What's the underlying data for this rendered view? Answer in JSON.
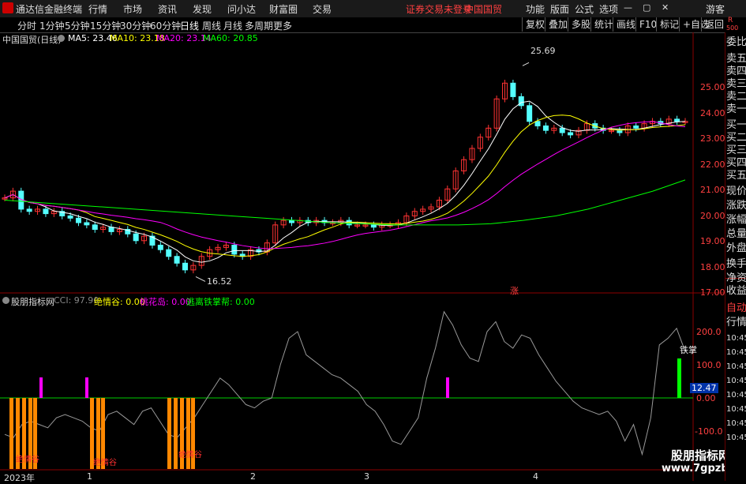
{
  "titlebar": {
    "app_name": "通达信金融终端",
    "menu": [
      "行情",
      "市场",
      "资讯",
      "发现",
      "问小达",
      "财富圈",
      "交易"
    ],
    "alert": "证券交易未登录",
    "stock": "中国国贸",
    "right_menu": [
      "功能",
      "版面",
      "公式",
      "选项"
    ],
    "guest": "游客"
  },
  "toolbar": {
    "periods": [
      "分时",
      "1分钟",
      "5分钟",
      "15分钟",
      "30分钟",
      "60分钟",
      "日线",
      "周线",
      "月线",
      "多周期",
      "更多"
    ],
    "selected": "日线",
    "buttons": [
      "复权",
      "叠加",
      "多股",
      "统计",
      "画线",
      "F10",
      "标记",
      "+自选",
      "返回"
    ]
  },
  "main_panel": {
    "title": "中国国贸(日线)",
    "ma": [
      {
        "label": "MA5: 23.46",
        "color": "#ffffff"
      },
      {
        "label": "MA10: 23.18",
        "color": "#ffff00"
      },
      {
        "label": "MA20: 23.14",
        "color": "#ff00ff"
      },
      {
        "label": "MA60: 20.85",
        "color": "#00ff00"
      }
    ],
    "high_label": "25.69",
    "low_label": "16.52",
    "zhang_label": "涨",
    "y_ticks": [
      "25.00",
      "24.00",
      "23.00",
      "22.00",
      "21.00",
      "20.00",
      "19.00",
      "18.00",
      "17.00"
    ]
  },
  "sub_panel": {
    "title": "股朋指标网",
    "items": [
      {
        "label": "CCI: 97.90",
        "color": "#888888"
      },
      {
        "label": "绝情谷: 0.00",
        "color": "#ffff00"
      },
      {
        "label": "桃花岛: 0.00",
        "color": "#ff00ff"
      },
      {
        "label": "逃离铁掌帮: 0.00",
        "color": "#00ff00"
      }
    ],
    "y_ticks": [
      "200.0",
      "100.0",
      "0.00",
      "-100.0"
    ],
    "current_value": "12.47",
    "bottom_text_1": "绝情谷",
    "bottom_text_2": "绝情谷",
    "bottom_text_3": "绝情谷",
    "side_label": "铁掌"
  },
  "x_axis": [
    "2023年",
    "1",
    "2",
    "3",
    "4"
  ],
  "side_panel": {
    "rr": "R",
    "num": "500",
    "items": [
      "委比",
      "卖五",
      "卖四",
      "卖三",
      "卖二",
      "卖一",
      "买一",
      "买二",
      "买三",
      "买四",
      "买五",
      "现价",
      "涨跌",
      "涨幅",
      "总量",
      "外盘",
      "换手",
      "净资",
      "收益",
      "自动",
      "行情"
    ],
    "times": [
      "10:45",
      "10:45",
      "10:45",
      "10:45",
      "10:45",
      "10:45",
      "10:45",
      "10:45",
      "10:45",
      "10:45"
    ]
  },
  "watermark": {
    "line1": "股朋指标网",
    "line2": "www.7gpzb.com"
  },
  "colors": {
    "up": "#ff3333",
    "down": "#54ffff",
    "ma5": "#ffffff",
    "ma10": "#ffff00",
    "ma20": "#ff00ff",
    "ma60": "#00ff00",
    "cci": "#999999"
  }
}
